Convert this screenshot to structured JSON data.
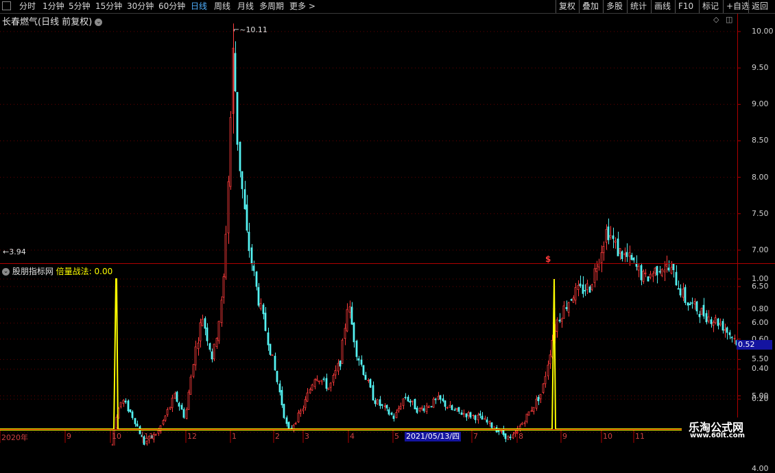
{
  "toolbar": {
    "left": [
      "分时",
      "1分钟",
      "5分钟",
      "15分钟",
      "30分钟",
      "60分钟",
      "日线",
      "周线",
      "月线",
      "多周期",
      "更多 >"
    ],
    "active": "日线",
    "right": [
      "复权",
      "叠加",
      "多股",
      "统计",
      "画线",
      "F10",
      "标记",
      "+自选",
      "返回"
    ]
  },
  "main_panel": {
    "title": "长春燃气(日线 前复权)",
    "high_label": "10.11",
    "low_label": "3.94",
    "signal_mark": "$",
    "y_ticks": [
      "10.00",
      "9.50",
      "9.00",
      "8.50",
      "8.00",
      "7.50",
      "7.00",
      "6.50",
      "6.00",
      "5.50",
      "5.00",
      "4.50",
      "4.00"
    ]
  },
  "sub_panel": {
    "title": "股朋指标网",
    "indicator_label": "倍量战法: 0.00",
    "y_ticks": [
      "1.00",
      "0.80",
      "0.60",
      "0.40",
      "0.20"
    ],
    "current_value": "0.52"
  },
  "x_axis": {
    "labels": [
      "2020年",
      "9",
      "10",
      "11",
      "12",
      "1",
      "2",
      "3",
      "4",
      "5",
      "7",
      "8",
      "9",
      "10",
      "11"
    ],
    "cursor_date": "2021/05/13/四"
  },
  "watermark": {
    "line1": "乐淘公式网",
    "line2": "www.60lt.com"
  },
  "chart_data": {
    "type": "candlestick",
    "series": [
      {
        "name": "price",
        "y_range": [
          3.94,
          10.11
        ]
      },
      {
        "name": "倍量战法",
        "spikes_at": [
          "2020-10",
          "2021-08"
        ],
        "peak": 1.0,
        "baseline": 0.0
      }
    ],
    "ylim_main": [
      3.8,
      10.2
    ],
    "ylim_sub": [
      0,
      1.05
    ]
  },
  "colors": {
    "up": "#ff3b3b",
    "down": "#54f2f2",
    "indicator": "#ffff00",
    "axis": "#b00000"
  }
}
